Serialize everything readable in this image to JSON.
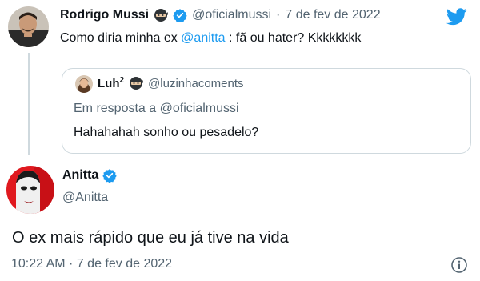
{
  "tweet1": {
    "author_name": "Rodrigo Mussi",
    "handle": "@oficialmussi",
    "separator": "·",
    "date": "7 de fev de 2022",
    "text_before": "Como diria minha ex ",
    "mention": "@anitta",
    "text_after": " : fã ou hater? Kkkkkkkk"
  },
  "quoted": {
    "author_name": "Luh",
    "author_sup": "2",
    "handle": "@luzinhacoments",
    "reply_prefix": "Em resposta a ",
    "reply_handle": "@oficialmussi",
    "text": "Hahahahah sonho ou pesadelo?"
  },
  "tweet2": {
    "author_name": "Anitta",
    "handle": "@Anitta",
    "text": "O ex mais rápido que eu já tive na vida",
    "timestamp": "10:22 AM · 7 de fev de 2022"
  },
  "colors": {
    "brand": "#1d9bf0",
    "muted": "#536471",
    "border": "#cfd9de"
  },
  "icons": [
    "verified-badge-icon",
    "ninja-emoji-icon",
    "twitter-bird-icon",
    "info-icon"
  ]
}
